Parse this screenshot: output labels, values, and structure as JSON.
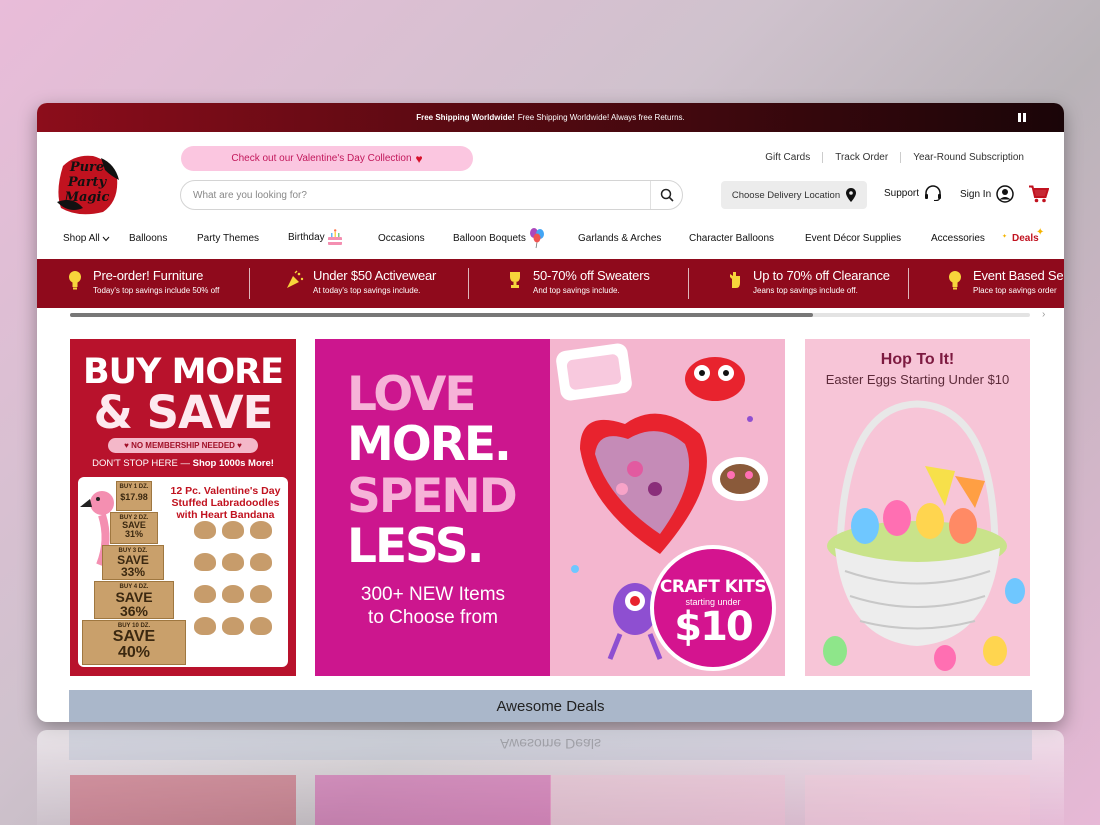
{
  "announcement": {
    "bold": "Free Shipping Worldwide!",
    "rest": "Free Shipping Worldwide! Always free Returns."
  },
  "brand": {
    "line1": "Pure",
    "line2": "Party",
    "line3": "Magic",
    "accent": "#c1121f"
  },
  "promo": {
    "label": "Check out our Valentine's Day Collection"
  },
  "search": {
    "placeholder": "What are you looking for?"
  },
  "toplinks": [
    "Gift Cards",
    "Track Order",
    "Year-Round Subscription"
  ],
  "delivery": {
    "label": "Choose Delivery Location"
  },
  "account": {
    "support": "Support",
    "signin": "Sign In"
  },
  "nav": [
    "Shop All",
    "Balloons",
    "Party Themes",
    "Birthday",
    "Occasions",
    "Balloon Boquets",
    "Garlands & Arches",
    "Character Balloons",
    "Event Décor Supplies",
    "Accessories",
    "Deals"
  ],
  "deals": [
    {
      "title": "Pre-order! Furniture",
      "sub": "Today's top savings include 50% off",
      "icon": "lightbulb-icon"
    },
    {
      "title": "Under $50 Activewear",
      "sub": "At today's top savings include.",
      "icon": "party-popper-icon"
    },
    {
      "title": "50-70% off Sweaters",
      "sub": "And top savings include.",
      "icon": "trophy-icon"
    },
    {
      "title": "Up to 70% off Clearance",
      "sub": "Jeans top savings include off.",
      "icon": "hand-icon"
    },
    {
      "title": "Event Based Se",
      "sub": "Place top savings order",
      "icon": "lightbulb-icon"
    }
  ],
  "banners": {
    "b1": {
      "line1": "BUY MORE",
      "line2": "& SAVE",
      "membership": "♥ NO MEMBERSHIP NEEDED ♥",
      "dont": "DON'T STOP HERE —",
      "dont_bold": "Shop 1000s More!",
      "product": "12 Pc. Valentine's Day Stuffed Labradoodles with Heart Bandana",
      "boxes": [
        {
          "top": "BUY 1 DZ.",
          "mid": "$17.98",
          "bot": ""
        },
        {
          "top": "BUY 2 DZ.",
          "mid": "SAVE",
          "bot": "31%"
        },
        {
          "top": "BUY 3 DZ.",
          "mid": "SAVE",
          "bot": "33%"
        },
        {
          "top": "BUY 4 DZ.",
          "mid": "SAVE",
          "bot": "36%"
        },
        {
          "top": "BUY 10 DZ.",
          "mid": "SAVE",
          "bot": "40%"
        }
      ]
    },
    "b2": {
      "l1": "LOVE",
      "l2": "MORE.",
      "l3": "SPEND",
      "l4": "LESS.",
      "sub1": "300+ NEW Items",
      "sub2": "to Choose from"
    },
    "b3": {
      "c1": "CRAFT KITS",
      "c2": "starting under",
      "c3": "$10"
    },
    "b4": {
      "title": "Hop To It!",
      "subtitle": "Easter Eggs Starting Under $10"
    }
  },
  "section": {
    "title": "Awesome Deals"
  }
}
